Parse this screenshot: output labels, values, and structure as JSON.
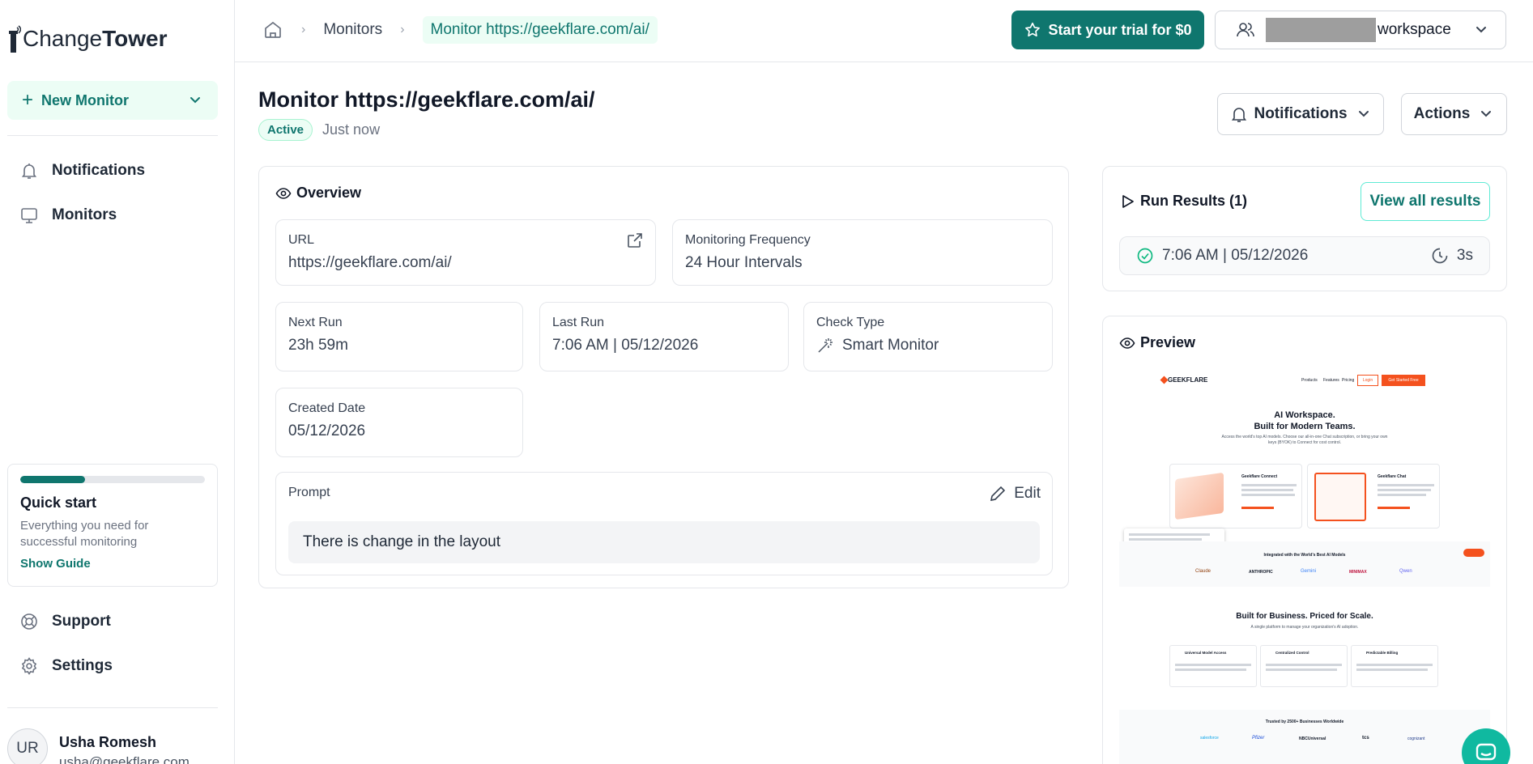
{
  "app": {
    "logo_light": "Change",
    "logo_bold": "Tower"
  },
  "sidebar": {
    "new_monitor_label": "New Monitor",
    "nav": [
      {
        "label": "Notifications",
        "icon": "bell-icon"
      },
      {
        "label": "Monitors",
        "icon": "monitor-icon"
      }
    ],
    "quick_start": {
      "progress": 0.35,
      "title": "Quick start",
      "description": "Everything you need for successful monitoring",
      "link": "Show Guide"
    },
    "bottom_nav": [
      {
        "label": "Support",
        "icon": "lifebuoy-icon"
      },
      {
        "label": "Settings",
        "icon": "gear-icon"
      }
    ],
    "user": {
      "initials": "UR",
      "name": "Usha Romesh",
      "email": "usha@geekflare.com"
    }
  },
  "topbar": {
    "breadcrumbs": [
      "Monitors",
      "Monitor https://geekflare.com/ai/"
    ],
    "trial_button": "Start your trial for $0",
    "workspace_label": "workspace"
  },
  "page": {
    "title": "Monitor https://geekflare.com/ai/",
    "status": "Active",
    "updated": "Just now",
    "notifications_button": "Notifications",
    "actions_button": "Actions"
  },
  "overview": {
    "title": "Overview",
    "url_label": "URL",
    "url_value": "https://geekflare.com/ai/",
    "frequency_label": "Monitoring Frequency",
    "frequency_value": "24 Hour Intervals",
    "next_run_label": "Next Run",
    "next_run_value": "23h 59m",
    "last_run_label": "Last Run",
    "last_run_value": "7:06 AM | 05/12/2026",
    "check_type_label": "Check Type",
    "check_type_value": "Smart Monitor",
    "created_label": "Created Date",
    "created_value": "05/12/2026",
    "prompt_label": "Prompt",
    "edit_label": "Edit",
    "prompt_value": "There is change in the layout"
  },
  "run_results": {
    "title": "Run Results (1)",
    "view_all": "View all results",
    "rows": [
      {
        "time": "7:06 AM | 05/12/2026",
        "duration": "3s"
      }
    ]
  },
  "preview": {
    "title": "Preview",
    "site": {
      "brand": "GEEKFLARE",
      "nav": [
        "Products",
        "Features",
        "Pricing"
      ],
      "login": "Login",
      "cta": "Get Started Free",
      "hero_line1": "AI Workspace.",
      "hero_line2": "Built for Modern Teams.",
      "hero_sub": "Access the world's top AI models. Choose our all-in-one Chat subscription, or bring your own keys (BYOK) to Connect for cost control.",
      "card1_title": "Geekflare Connect",
      "card2_title": "Geekflare Chat",
      "integrated": "Integrated with the World's Best AI Models",
      "models": [
        "Claude",
        "ANTHROPIC",
        "Gemini",
        "MINIMAX",
        "Qwen"
      ],
      "pricing_title": "Built for Business. Priced for Scale.",
      "pricing_sub": "A single platform to manage your organization's AI adoption.",
      "features": [
        "Universal Model Access",
        "Centralized Control",
        "Predictable Billing"
      ],
      "trusted": "Trusted by 2500+ Businesses Worldwide",
      "logos": [
        "salesforce",
        "Pfizer",
        "NBCUniversal",
        "tcs",
        "cognizant"
      ]
    }
  },
  "colors": {
    "accent": "#0f766e",
    "accent_light": "#ecfdf5",
    "preview_orange": "#f4511e"
  }
}
